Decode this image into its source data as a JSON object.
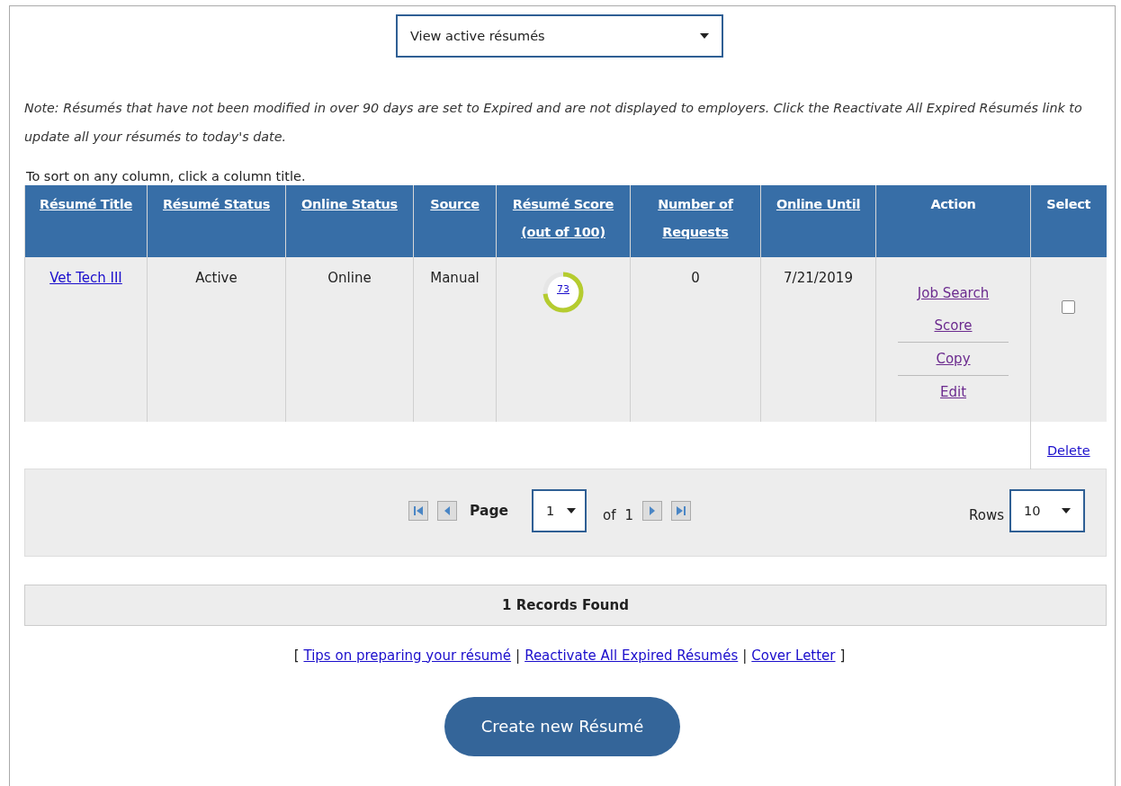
{
  "view_select": {
    "value": "View active résumés"
  },
  "note": "Note: Résumés that have not been modified in over 90 days are set to Expired and are not displayed to employers. Click the Reactivate All Expired Résumés link to update all your résumés to today's date.",
  "sort_hint": "To sort on any column, click a column title.",
  "table": {
    "columns": [
      "Résumé Title",
      "Résumé Status",
      "Online Status",
      "Source",
      "Résumé Score (out of 100)",
      "Number of Requests",
      "Online Until",
      "Action",
      "Select"
    ],
    "rows": [
      {
        "title": "Vet Tech III",
        "status": "Active",
        "online_status": "Online",
        "source": "Manual",
        "score": {
          "text": "73",
          "level": 0.73
        },
        "requests": "0",
        "online_until": "7/21/2019",
        "actions": [
          "Job Search Score ",
          "Copy",
          "Edit"
        ],
        "checked": false
      }
    ],
    "delete": "Delete"
  },
  "pager": {
    "page_label": "Page",
    "page": "1",
    "of_label": "of",
    "total": "1",
    "rows_label": "Rows",
    "rows": "10"
  },
  "records": "1 Records Found",
  "footer": {
    "open": "[",
    "links": [
      "Tips on preparing your résumé",
      "Reactivate All Expired Résumés",
      "Cover Letter"
    ],
    "separators": [
      "|",
      "|"
    ],
    "close": "]"
  },
  "create_button": "Create new Résumé"
}
